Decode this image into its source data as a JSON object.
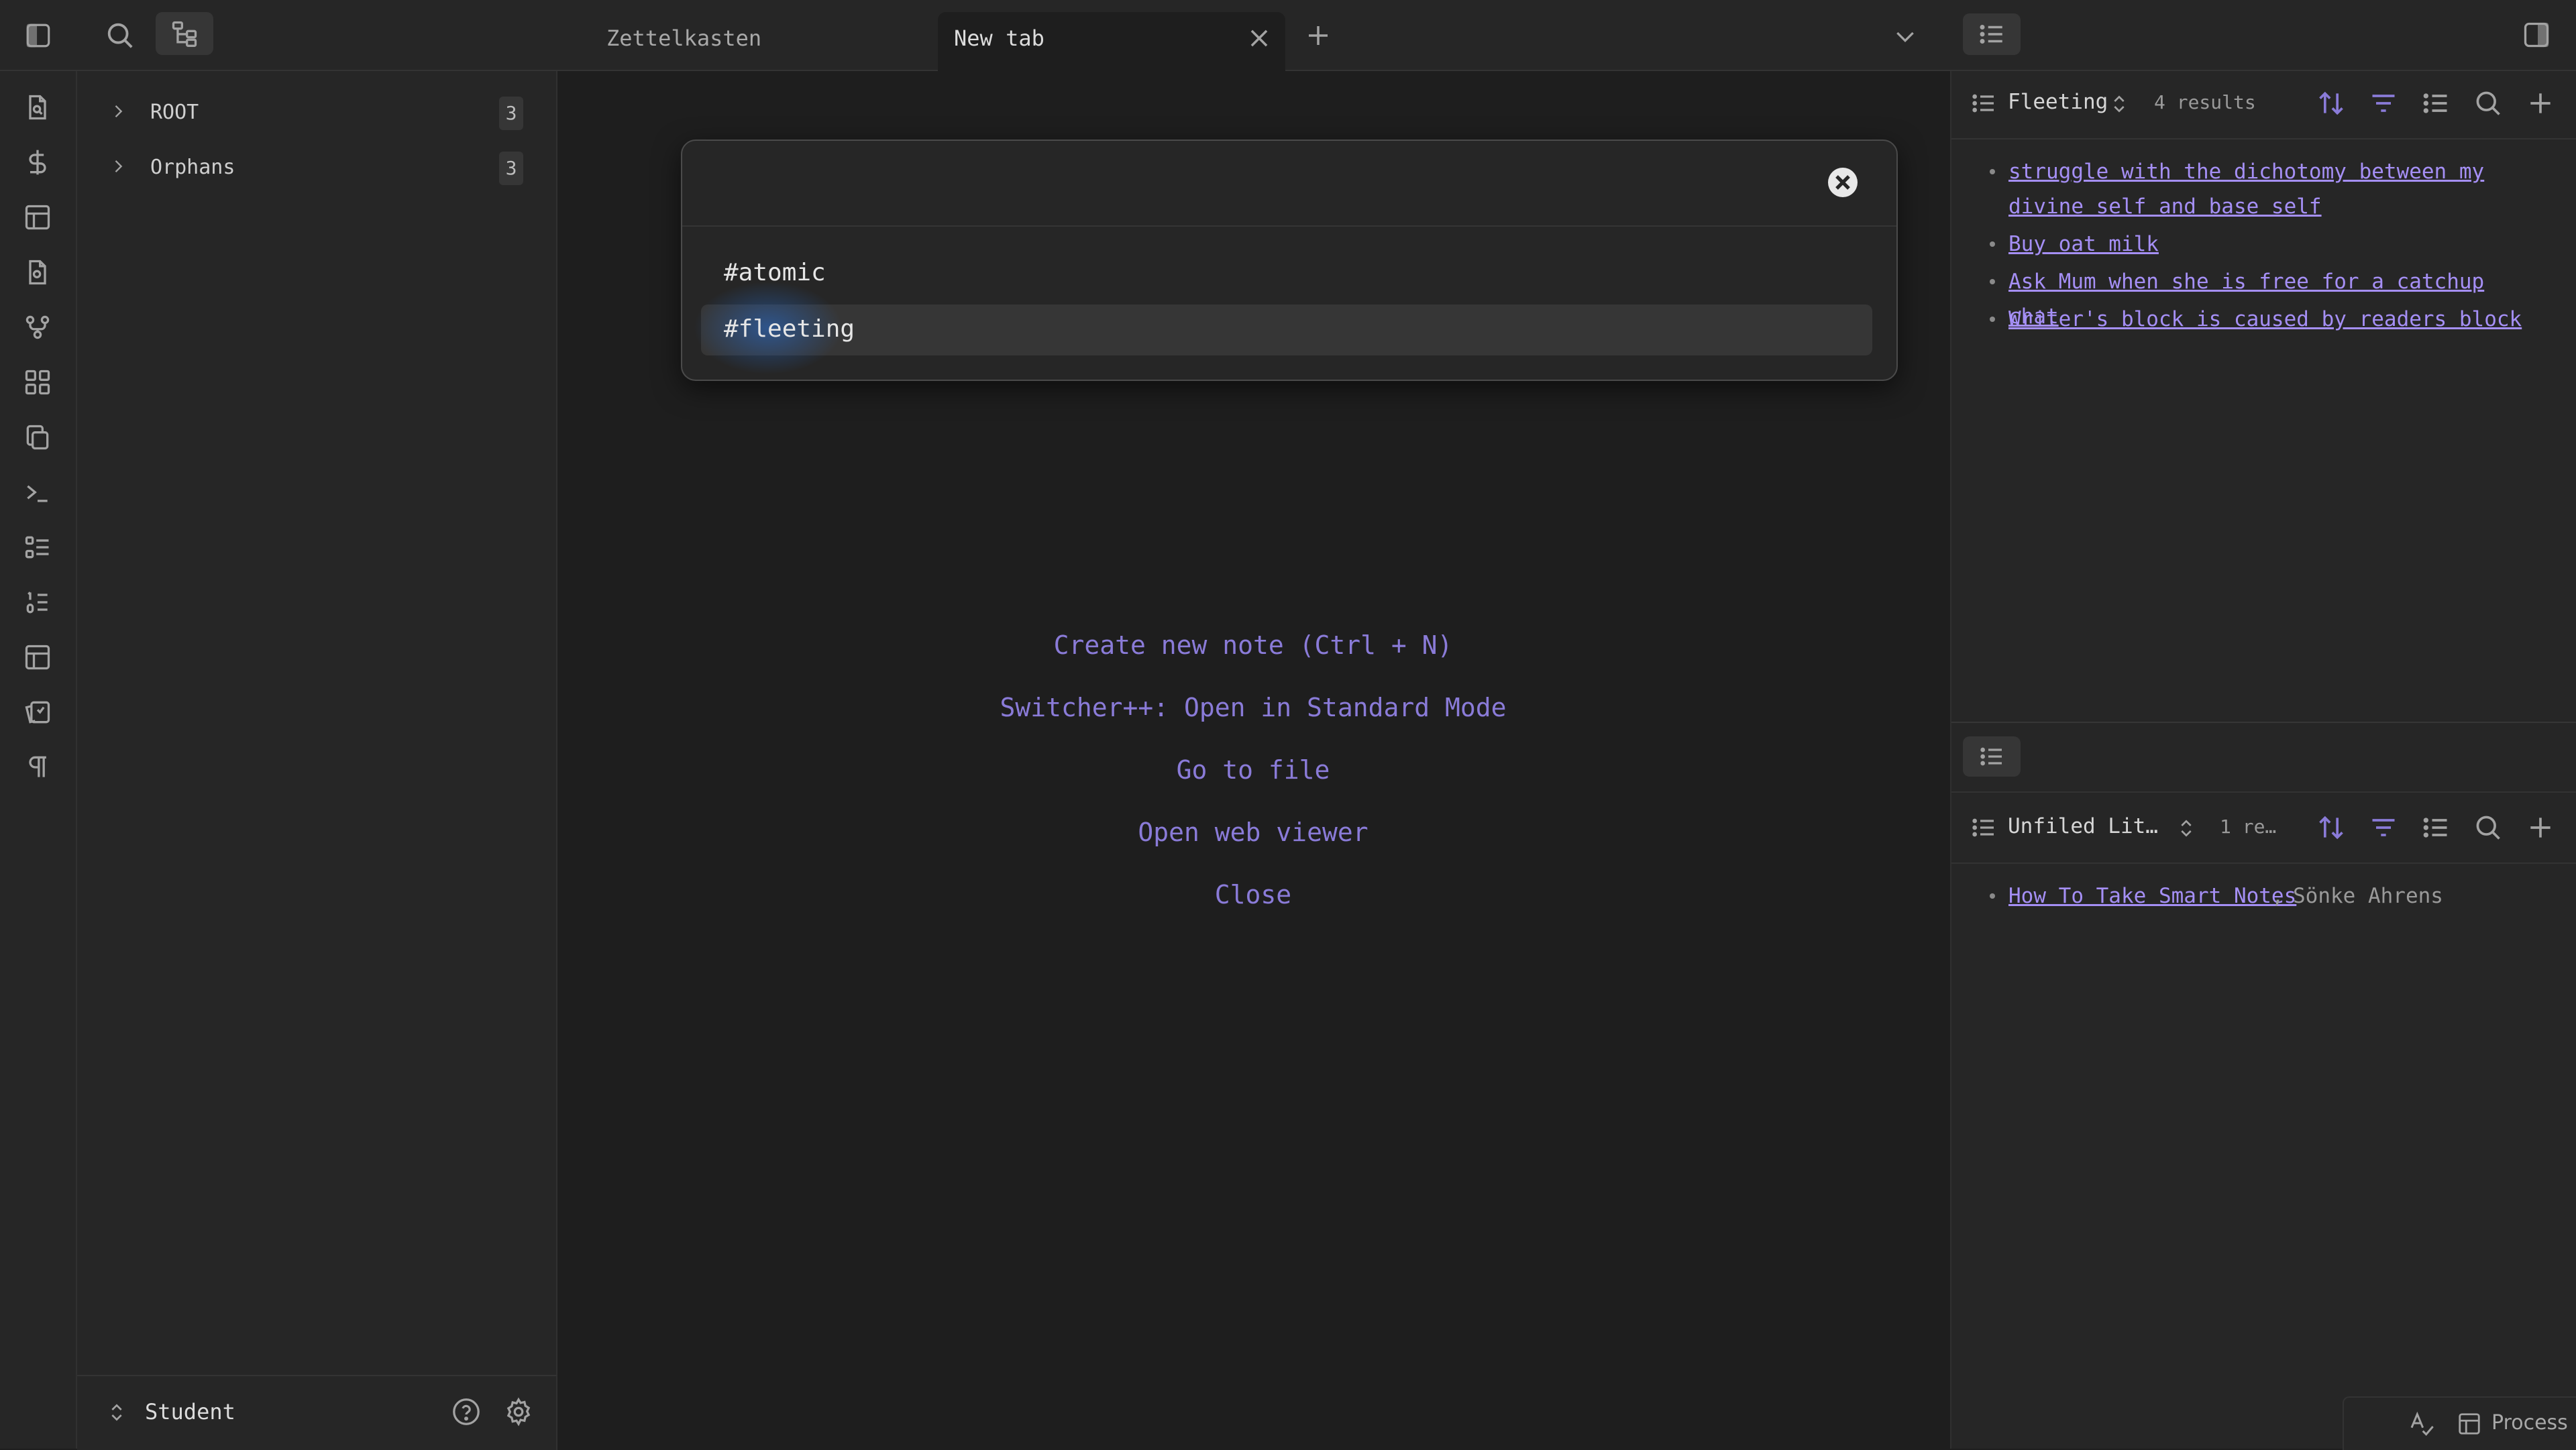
{
  "tabs": [
    {
      "label": "Zettelkasten",
      "active": false
    },
    {
      "label": "New tab",
      "active": true
    }
  ],
  "left_tree": [
    {
      "label": "ROOT",
      "count": "3"
    },
    {
      "label": "Orphans",
      "count": "3"
    }
  ],
  "vault": {
    "name": "Student"
  },
  "modal": {
    "input_value": "",
    "suggestions": [
      "#atomic",
      "#fleeting"
    ],
    "selected_index": 1
  },
  "empty_state": {
    "actions": [
      "Create new note (Ctrl + N)",
      "Switcher++: Open in Standard Mode",
      "Go to file",
      "Open web viewer",
      "Close"
    ]
  },
  "right_top": {
    "title": "Fleeting",
    "results": "4 results",
    "items": [
      "struggle with the dichotomy between my divine self and base self",
      "Buy oat milk",
      "Ask Mum when she is free for a catchup chat",
      "Writer's block is caused by readers block"
    ]
  },
  "right_bottom": {
    "title": "Unfiled Lit…",
    "results": "1 re…",
    "items": [
      {
        "link": "How To Take Smart Notes",
        "sep": ",",
        "author": "Sönke Ahrens"
      }
    ]
  },
  "status_bar": {
    "label": "Process"
  },
  "colors": {
    "accent": "#8a7bd8",
    "link": "#a58ff5",
    "background": "#1e1e1e",
    "panel": "#262626"
  }
}
